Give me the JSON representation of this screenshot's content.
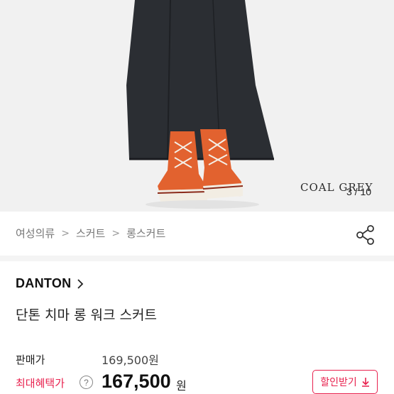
{
  "product_image": {
    "watermark": "COAL GREY",
    "current_index": "3",
    "total": "10",
    "counter_text": "3 / 10"
  },
  "breadcrumb": {
    "items": [
      "여성의류",
      "스커트",
      "롱스커트"
    ],
    "separator": ">"
  },
  "share": {
    "icon": "share-icon"
  },
  "brand": {
    "name": "DANTON",
    "icon": "chevron-right-icon"
  },
  "product": {
    "title": "단톤 치마 롱 워크 스커트"
  },
  "pricing": {
    "sale_label": "판매가",
    "sale_price": "169,500원",
    "max_benefit_label": "최대혜택가",
    "help_icon": "?",
    "max_benefit_price": "167,500",
    "currency_unit": "원",
    "coupon_button_label": "할인받기",
    "coupon_icon": "download-icon"
  },
  "colors": {
    "accent_red": "#e8214e",
    "text_primary": "#111111",
    "text_muted": "#777777",
    "image_bg": "#f1f1f1"
  }
}
